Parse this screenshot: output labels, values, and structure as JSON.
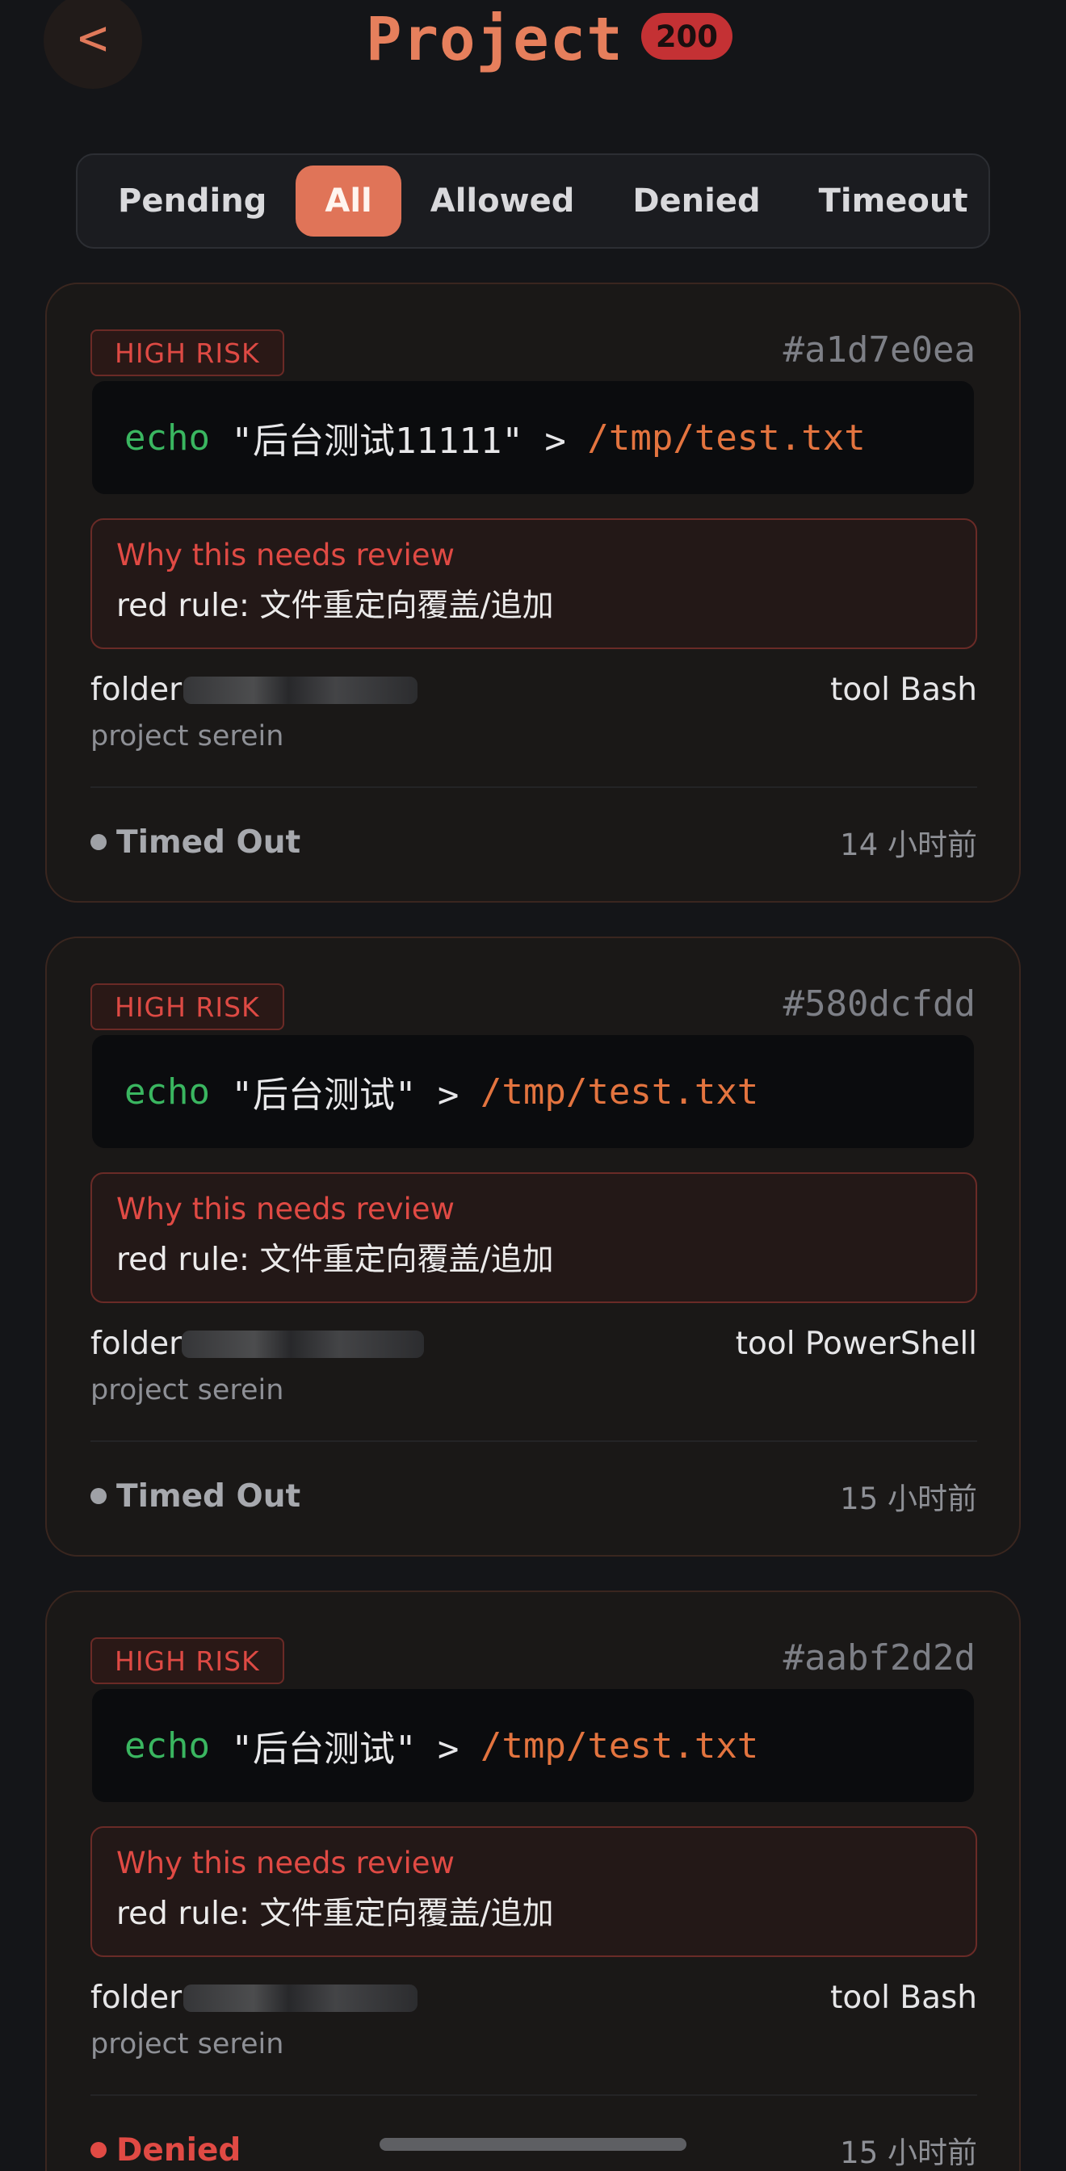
{
  "header": {
    "back_label": "<",
    "title": "Project",
    "count": "200"
  },
  "tabs": [
    {
      "label": "Pending",
      "active": false
    },
    {
      "label": "All",
      "active": true
    },
    {
      "label": "Allowed",
      "active": false
    },
    {
      "label": "Denied",
      "active": false
    },
    {
      "label": "Timeout",
      "active": false
    }
  ],
  "cards": [
    {
      "risk": "HIGH RISK",
      "hash": "#a1d7e0ea",
      "command": {
        "keyword": "echo",
        "string": " \"后台测试11111\" > ",
        "path": "/tmp/test.txt"
      },
      "review_title": "Why this needs review",
      "review_rule": "red rule: 文件重定向覆盖/追加",
      "folder_label": "folder",
      "tool": "tool Bash",
      "project": "project serein",
      "status": "Timed Out",
      "time": "14 小时前"
    },
    {
      "risk": "HIGH RISK",
      "hash": "#580dcfdd",
      "command": {
        "keyword": "echo",
        "string": " \"后台测试\" > ",
        "path": "/tmp/test.txt"
      },
      "review_title": "Why this needs review",
      "review_rule": "red rule: 文件重定向覆盖/追加",
      "folder_label": "folder",
      "tool": "tool PowerShell",
      "project": "project serein",
      "status": "Timed Out",
      "time": "15 小时前"
    },
    {
      "risk": "HIGH RISK",
      "hash": "#aabf2d2d",
      "command": {
        "keyword": "echo",
        "string": " \"后台测试\" > ",
        "path": "/tmp/test.txt"
      },
      "review_title": "Why this needs review",
      "review_rule": "red rule: 文件重定向覆盖/追加",
      "folder_label": "folder",
      "tool": "tool Bash",
      "project": "project serein",
      "status": "Denied",
      "time": "15 小时前"
    }
  ],
  "colors": {
    "accent": "#e07458",
    "danger": "#e04a44",
    "background": "#141518"
  }
}
